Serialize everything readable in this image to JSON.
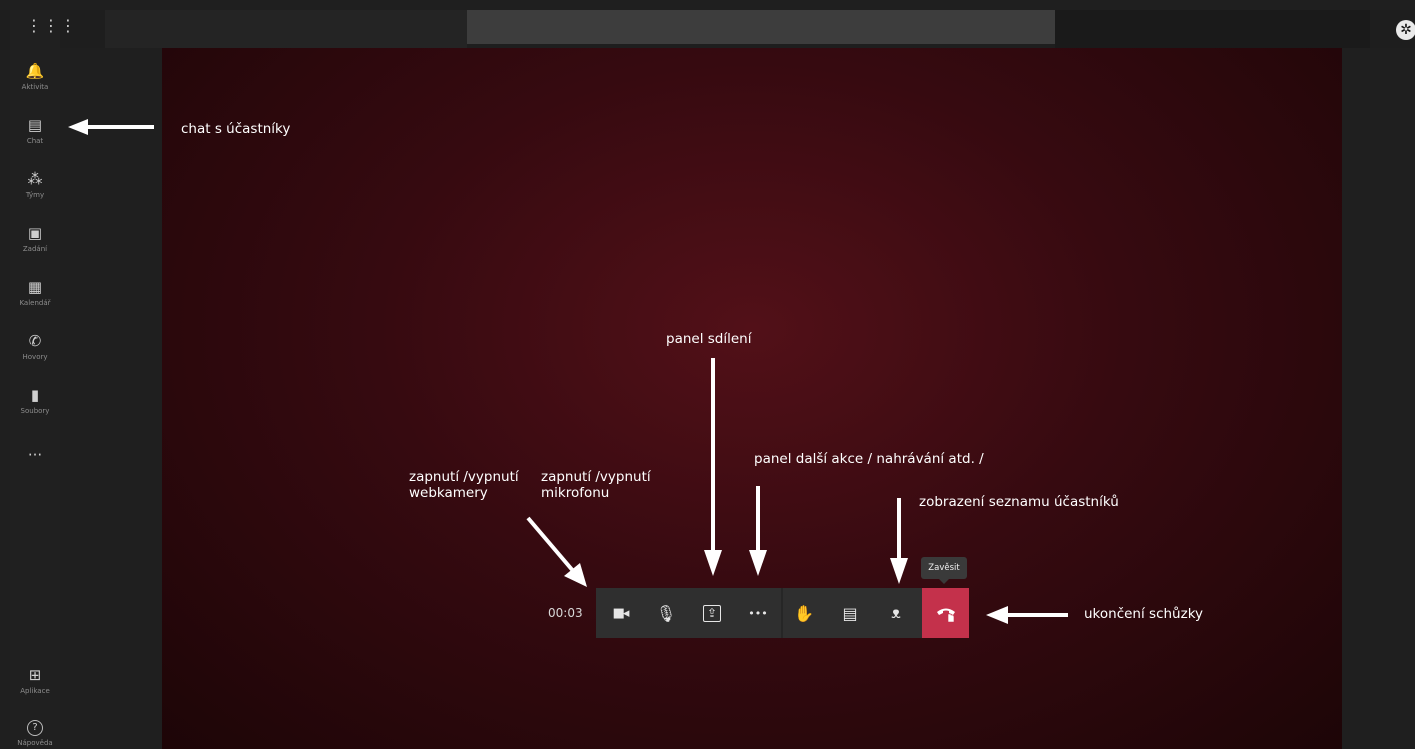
{
  "rail": {
    "app_launcher_icon": "waffle-icon",
    "items": [
      {
        "icon": "bell-icon",
        "glyph": "🔔",
        "label": "Aktivita"
      },
      {
        "icon": "chat-icon",
        "glyph": "▤",
        "label": "Chat"
      },
      {
        "icon": "teams-icon",
        "glyph": "⁂",
        "label": "Týmy"
      },
      {
        "icon": "assignments-icon",
        "glyph": "▣",
        "label": "Zadání"
      },
      {
        "icon": "calendar-icon",
        "glyph": "▦",
        "label": "Kalendář"
      },
      {
        "icon": "calls-icon",
        "glyph": "✆",
        "label": "Hovory"
      },
      {
        "icon": "files-icon",
        "glyph": "▮",
        "label": "Soubory"
      },
      {
        "icon": "more-icon",
        "glyph": "···",
        "label": ""
      },
      {
        "icon": "apps-icon",
        "glyph": "⊞",
        "label": "Aplikace"
      },
      {
        "icon": "help-icon",
        "glyph": "?",
        "label": "Nápověda"
      }
    ]
  },
  "annotations": {
    "chat": "chat s účastníky",
    "share": "panel sdílení",
    "more_actions": "panel další akce / nahrávání atd. /",
    "camera_line1": "zapnutí /vypnutí",
    "camera_line2": "webkamery",
    "mic_line1": "zapnutí /vypnutí",
    "mic_line2": "mikrofonu",
    "participants": "zobrazení seznamu účastníků",
    "hangup": "ukončení schůzky"
  },
  "call": {
    "timer": "00:03",
    "hangup_tooltip": "Zavěsit",
    "buttons": [
      {
        "name": "camera-icon",
        "glyph": "■◂"
      },
      {
        "name": "microphone-icon",
        "glyph": "🎙"
      },
      {
        "name": "share-tray-icon",
        "glyph": "⇪"
      },
      {
        "name": "more-actions-icon",
        "glyph": "•••"
      },
      {
        "name": "raise-hand-icon",
        "glyph": "✋"
      },
      {
        "name": "chat-toggle-icon",
        "glyph": "▤"
      },
      {
        "name": "participants-icon",
        "glyph": "ᴥ"
      }
    ]
  },
  "colors": {
    "hangup_red": "#c4314b",
    "stage_maroon": "#3a0a10",
    "rail_bg": "#202020"
  }
}
